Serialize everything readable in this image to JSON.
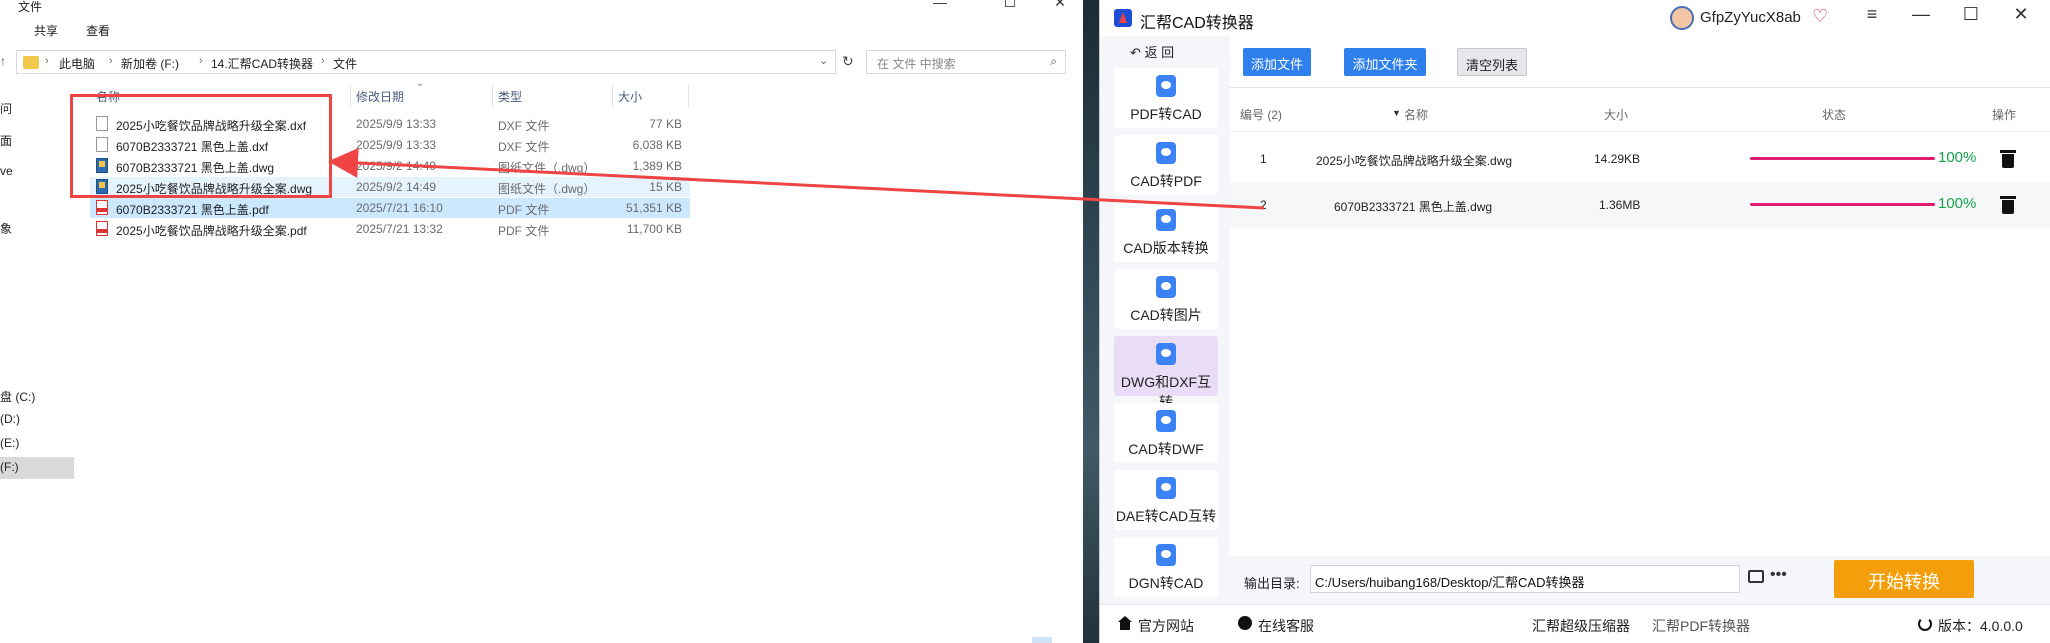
{
  "explorer": {
    "title": "文件",
    "menu": [
      "共享",
      "查看"
    ],
    "breadcrumb": [
      "此电脑",
      "新加卷 (F:)",
      "14.汇帮CAD转换器",
      "文件"
    ],
    "search_placeholder": "在 文件 中搜索",
    "columns": {
      "name": "名称",
      "date": "修改日期",
      "type": "类型",
      "size": "大小"
    },
    "nav": [
      "问",
      "面",
      "ve",
      "象",
      "盘 (C:)",
      "(D:)",
      "(E:)",
      "(F:)"
    ],
    "files": [
      {
        "name": "2025小吃餐饮品牌战略升级全案.dxf",
        "date": "2025/9/9 13:33",
        "type": "DXF 文件",
        "size": "77 KB",
        "icon": "dxf-file-icon"
      },
      {
        "name": "6070B2333721 黑色上盖.dxf",
        "date": "2025/9/9 13:33",
        "type": "DXF 文件",
        "size": "6,038 KB",
        "icon": "dxf-file-icon"
      },
      {
        "name": "6070B2333721 黑色上盖.dwg",
        "date": "2025/9/2 14:49",
        "type": "图纸文件（.dwg）",
        "size": "1,389 KB",
        "icon": "dwg-file-icon"
      },
      {
        "name": "2025小吃餐饮品牌战略升级全案.dwg",
        "date": "2025/9/2 14:49",
        "type": "图纸文件（.dwg）",
        "size": "15 KB",
        "icon": "dwg-file-icon"
      },
      {
        "name": "6070B2333721 黑色上盖.pdf",
        "date": "2025/7/21 16:10",
        "type": "PDF 文件",
        "size": "51,351 KB",
        "icon": "pdf-file-icon"
      },
      {
        "name": "2025小吃餐饮品牌战略升级全案.pdf",
        "date": "2025/7/21 13:32",
        "type": "PDF 文件",
        "size": "11,700 KB",
        "icon": "pdf-file-icon"
      }
    ]
  },
  "app": {
    "name": "汇帮CAD转换器",
    "user": "GfpZyYucX8ab",
    "back": "返 回",
    "sidebar": [
      {
        "label": "PDF转CAD"
      },
      {
        "label": "CAD转PDF"
      },
      {
        "label": "CAD版本转换"
      },
      {
        "label": "CAD转图片"
      },
      {
        "label": "DWG和DXF互转"
      },
      {
        "label": "CAD转DWF"
      },
      {
        "label": "DAE转CAD互转"
      },
      {
        "label": "DGN转CAD"
      }
    ],
    "toolbar": {
      "add_file": "添加文件",
      "add_folder": "添加文件夹",
      "clear": "清空列表"
    },
    "table": {
      "col_index": "编号 (2)",
      "col_name": "名称",
      "col_size": "大小",
      "col_status": "状态",
      "col_action": "操作",
      "rows": [
        {
          "index": "1",
          "name": "2025小吃餐饮品牌战略升级全案.dwg",
          "size": "14.29KB",
          "progress": 1.0,
          "percent": "100%"
        },
        {
          "index": "2",
          "name": "6070B2333721 黑色上盖.dwg",
          "size": "1.36MB",
          "progress": 1.0,
          "percent": "100%"
        }
      ]
    },
    "output": {
      "label": "输出目录:",
      "path": "C:/Users/huibang168/Desktop/汇帮CAD转换器",
      "start": "开始转换"
    },
    "footer": {
      "website": "官方网站",
      "service": "在线客服",
      "compress": "汇帮超级压缩器",
      "pdf": "汇帮PDF转换器",
      "version": "版本：4.0.0.0"
    },
    "colors": {
      "accent": "#2f80ed",
      "start": "#f59e0b",
      "progress": "#e11d73",
      "percent": "#16a34a",
      "highlight": "#ef4444"
    }
  }
}
